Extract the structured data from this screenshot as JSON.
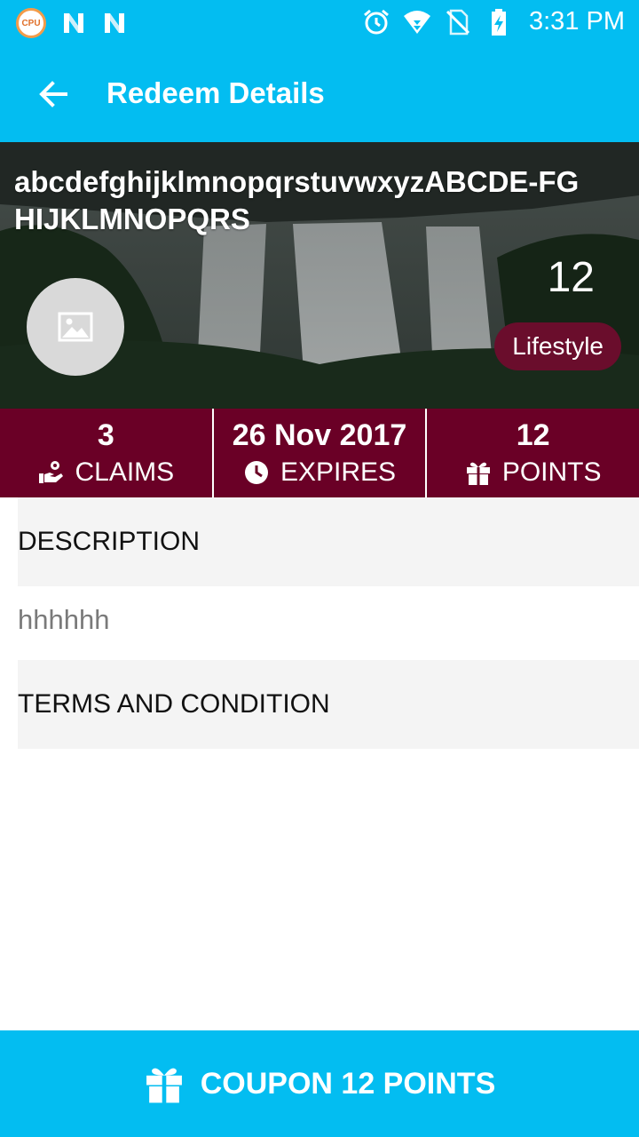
{
  "status_bar": {
    "cpu_icon_text": "CPU",
    "time": "3:31 PM",
    "left_icons": [
      "cpu-icon",
      "n-icon",
      "n-icon"
    ],
    "right_icons": [
      "alarm-icon",
      "wifi-icon",
      "no-sim-icon",
      "battery-charging-icon"
    ]
  },
  "app_bar": {
    "title": "Redeem Details",
    "back_icon": "arrow-left-icon"
  },
  "hero": {
    "title": "abcdefghijklmnopqrstuvwxyzABCDE-FGHIJKLMNOPQRS",
    "count": "12",
    "category": "Lifestyle",
    "avatar_icon": "image-placeholder-icon"
  },
  "stats": {
    "claims": {
      "value": "3",
      "label": "CLAIMS",
      "icon": "hand-coin-icon"
    },
    "expires": {
      "value": "26 Nov 2017",
      "label": "EXPIRES",
      "icon": "clock-icon"
    },
    "points": {
      "value": "12",
      "label": "POINTS",
      "icon": "gift-icon"
    }
  },
  "description": {
    "header": "DESCRIPTION",
    "text": "hhhhhh"
  },
  "terms": {
    "header": "TERMS AND CONDITION"
  },
  "redeem_button": {
    "label": "COUPON 12 POINTS",
    "icon": "gift-icon"
  },
  "colors": {
    "primary": "#03BDF1",
    "accent": "#6A0026",
    "section_bg": "#F4F4F4"
  }
}
